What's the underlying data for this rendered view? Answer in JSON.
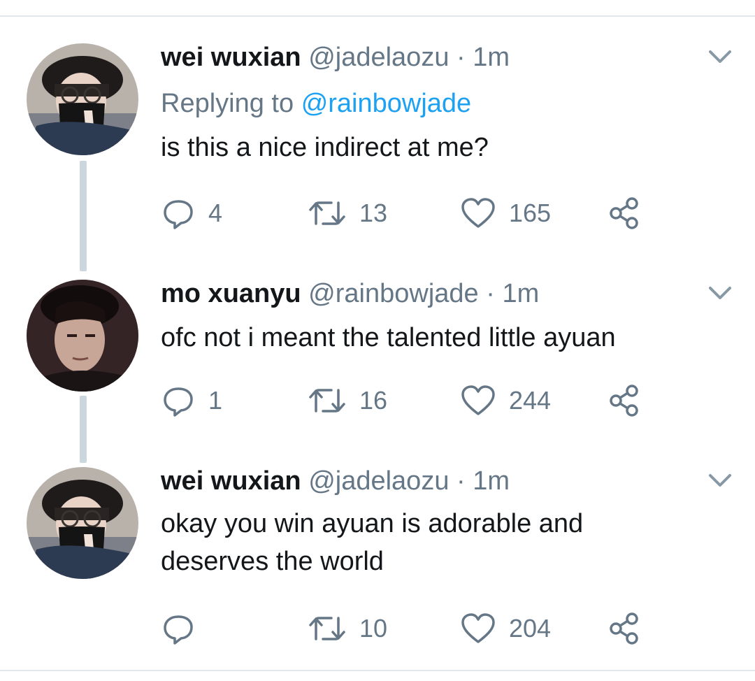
{
  "tweets": [
    {
      "name": "wei wuxian",
      "handle": "@jadelaozu",
      "separator": "·",
      "time": "1m",
      "reply_prefix": "Replying to",
      "reply_mention": "@rainbowjade",
      "text": "is this a nice indirect at me?",
      "reply_count": "4",
      "retweet_count": "13",
      "like_count": "165"
    },
    {
      "name": "mo xuanyu",
      "handle": "@rainbowjade",
      "separator": "·",
      "time": "1m",
      "text": "ofc not i meant the talented little ayuan",
      "reply_count": "1",
      "retweet_count": "16",
      "like_count": "244"
    },
    {
      "name": "wei wuxian",
      "handle": "@jadelaozu",
      "separator": "·",
      "time": "1m",
      "text": "okay you win ayuan is adorable and deserves the world",
      "reply_count": "",
      "retweet_count": "10",
      "like_count": "204"
    }
  ],
  "colors": {
    "text": "#14171a",
    "secondary": "#657786",
    "link": "#1da1f2",
    "thread_line": "#ccd6dd",
    "border": "#e1e8ed"
  },
  "icons": [
    "reply-icon",
    "retweet-icon",
    "like-icon",
    "share-icon",
    "caret-down-icon"
  ]
}
